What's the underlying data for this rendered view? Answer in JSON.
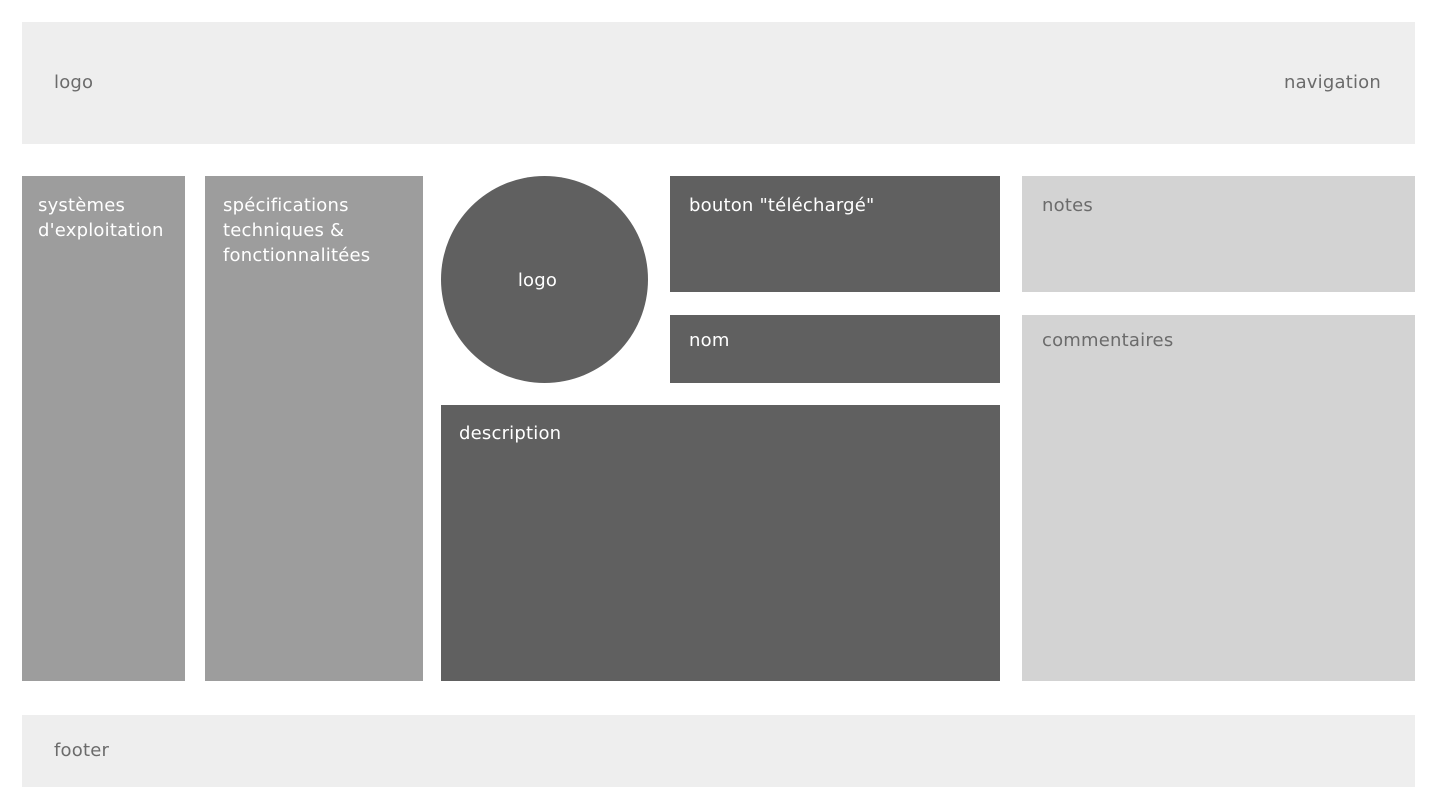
{
  "header": {
    "logo_label": "logo",
    "nav_label": "navigation"
  },
  "columns": {
    "os_label": "systèmes d'exploitation",
    "specs_label": "spécifications techniques & fonctionnalitées"
  },
  "app": {
    "logo_label": "logo",
    "download_label": "bouton \"téléchargé\"",
    "name_label": "nom",
    "description_label": "description"
  },
  "side": {
    "notes_label": "notes",
    "comments_label": "commentaires"
  },
  "footer": {
    "label": "footer"
  },
  "colors": {
    "light": "#eeeeee",
    "mid": "#9d9d9d",
    "dark": "#606060",
    "pale": "#d3d3d3"
  }
}
